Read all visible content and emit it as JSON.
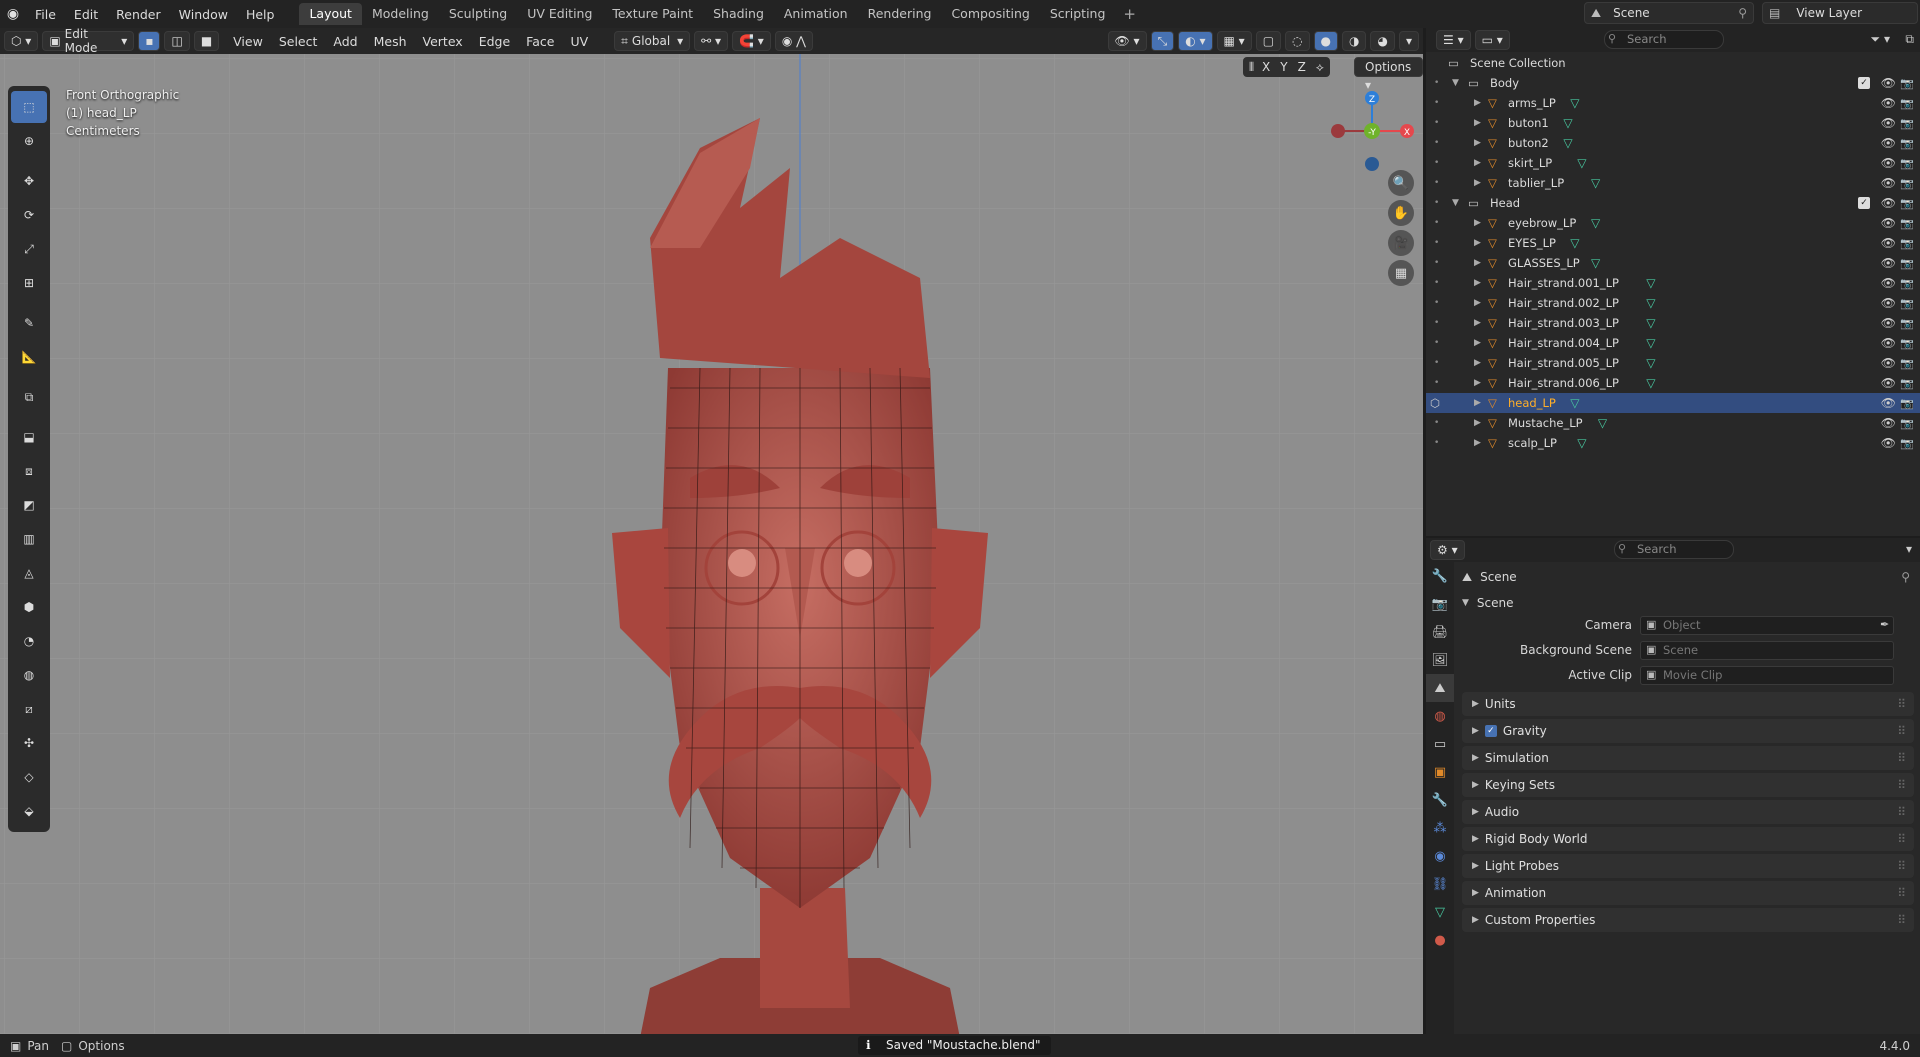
{
  "topbar": {
    "menus": [
      "File",
      "Edit",
      "Render",
      "Window",
      "Help"
    ],
    "workspaces": [
      "Layout",
      "Modeling",
      "Sculpting",
      "UV Editing",
      "Texture Paint",
      "Shading",
      "Animation",
      "Rendering",
      "Compositing",
      "Scripting"
    ],
    "active_workspace": "Layout",
    "scene": "Scene",
    "view_layer": "View Layer"
  },
  "viewport": {
    "mode": "Edit Mode",
    "menus": [
      "View",
      "Select",
      "Add",
      "Mesh",
      "Vertex",
      "Edge",
      "Face",
      "UV"
    ],
    "transform_orientation": "Global",
    "options_label": "Options",
    "axis_labels": [
      "X",
      "Y",
      "Z"
    ],
    "info_view": "Front Orthographic",
    "info_object": "(1) head_LP",
    "info_units": "Centimeters",
    "gizmo": {
      "z": "Z",
      "y": "-Y",
      "x": "X"
    }
  },
  "outliner": {
    "search_placeholder": "Search",
    "root": "Scene Collection",
    "collections": [
      {
        "name": "Body",
        "objects": [
          "arms_LP",
          "buton1",
          "buton2",
          "skirt_LP",
          "tablier_LP"
        ]
      },
      {
        "name": "Head",
        "objects": [
          "eyebrow_LP",
          "EYES_LP",
          "GLASSES_LP",
          "Hair_strand.001_LP",
          "Hair_strand.002_LP",
          "Hair_strand.003_LP",
          "Hair_strand.004_LP",
          "Hair_strand.005_LP",
          "Hair_strand.006_LP",
          "head_LP",
          "Mustache_LP",
          "scalp_LP"
        ]
      }
    ],
    "selected": "head_LP"
  },
  "properties": {
    "search_placeholder": "Search",
    "context": "Scene",
    "section": "Scene",
    "fields": [
      {
        "label": "Camera",
        "placeholder": "Object"
      },
      {
        "label": "Background Scene",
        "placeholder": "Scene"
      },
      {
        "label": "Active Clip",
        "placeholder": "Movie Clip"
      }
    ],
    "panels": [
      "Units",
      "Gravity",
      "Simulation",
      "Keying Sets",
      "Audio",
      "Rigid Body World",
      "Light Probes",
      "Animation",
      "Custom Properties"
    ],
    "gravity_checked": true
  },
  "statusbar": {
    "left_pan": "Pan",
    "left_options": "Options",
    "message": "Saved \"Moustache.blend\"",
    "version": "4.4.0"
  },
  "colors": {
    "accent": "#4772b3",
    "selected_row": "#334d80",
    "selected_text": "#ffaf29",
    "mesh_icon": "#48c8a0",
    "head_skin": "#b4534a"
  }
}
